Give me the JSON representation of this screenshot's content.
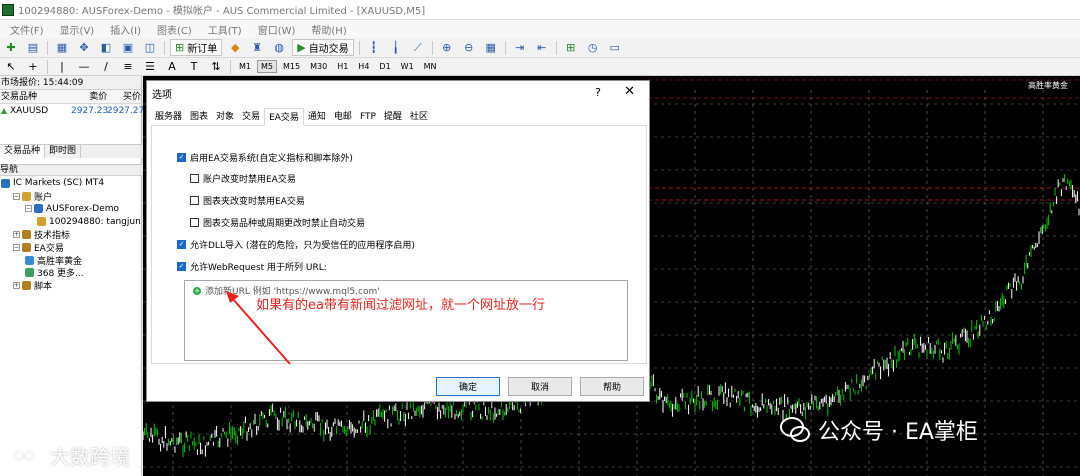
{
  "window": {
    "title": "100294880: AUSForex-Demo - 模拟帐户 - AUS Commercial Limited - [XAUUSD,M5]"
  },
  "menu": [
    "文件(F)",
    "显示(V)",
    "插入(I)",
    "图表(C)",
    "工具(T)",
    "窗口(W)",
    "帮助(H)"
  ],
  "toolbar": {
    "new_order_label": "新订单",
    "auto_trade_label": "自动交易"
  },
  "timeframes": [
    "M1",
    "M5",
    "M15",
    "M30",
    "H1",
    "H4",
    "D1",
    "W1",
    "MN"
  ],
  "timeframe_active": "M5",
  "market_watch": {
    "header": "市场报价: 15:44:09",
    "col_symbol": "交易品种",
    "col_bid": "卖价",
    "col_ask": "买价",
    "rows": [
      {
        "symbol": "XAUUSD",
        "bid": "2927.23",
        "ask": "2927.27"
      }
    ],
    "tabs": [
      "交易品种",
      "即时图"
    ]
  },
  "navigator": {
    "header": "导航",
    "items": [
      {
        "label": "IC Markets (SC) MT4",
        "indent": 0,
        "toggle": ""
      },
      {
        "label": "账户",
        "indent": 1,
        "toggle": "-"
      },
      {
        "label": "AUSForex-Demo",
        "indent": 2,
        "toggle": "-"
      },
      {
        "label": "100294880: tangjun",
        "indent": 3,
        "toggle": ""
      },
      {
        "label": "技术指标",
        "indent": 1,
        "toggle": "+"
      },
      {
        "label": "EA交易",
        "indent": 1,
        "toggle": "-"
      },
      {
        "label": "高胜率黄金",
        "indent": 2,
        "toggle": ""
      },
      {
        "label": "368 更多...",
        "indent": 2,
        "toggle": ""
      },
      {
        "label": "脚本",
        "indent": 1,
        "toggle": "+"
      }
    ]
  },
  "chart": {
    "label": "高胜率黄金"
  },
  "dialog": {
    "title": "选项",
    "help": "?",
    "close": "✕",
    "tabs": [
      "服务器",
      "图表",
      "对象",
      "交易",
      "EA交易",
      "通知",
      "电邮",
      "FTP",
      "提醒",
      "社区"
    ],
    "active_tab": "EA交易",
    "options": [
      {
        "label": "启用EA交易系统(自定义指标和脚本除外)",
        "checked": true
      },
      {
        "label": "账户改变时禁用EA交易",
        "checked": false
      },
      {
        "label": "图表夹改变时禁用EA交易",
        "checked": false
      },
      {
        "label": "图表交易品种或周期更改时禁止自动交易",
        "checked": false
      },
      {
        "label": "允许DLL导入 (潜在的危险，只为受信任的应用程序启用)",
        "checked": true
      },
      {
        "label": "允许WebRequest 用于所列 URL:",
        "checked": true
      }
    ],
    "url_add_label": "添加新URL 例如 'https://www.mql5.com'",
    "buttons": {
      "ok": "确定",
      "cancel": "取消",
      "help": "帮助"
    }
  },
  "annotation": "如果有的ea带有新闻过滤网址，就一个网址放一行",
  "watermarks": {
    "left": "大数跨境",
    "right": "公众号 · EA掌柜"
  },
  "colors": {
    "candle_green": "#00c800",
    "dialog_accent": "#1a68c8",
    "annotation_red": "#e8231f"
  }
}
